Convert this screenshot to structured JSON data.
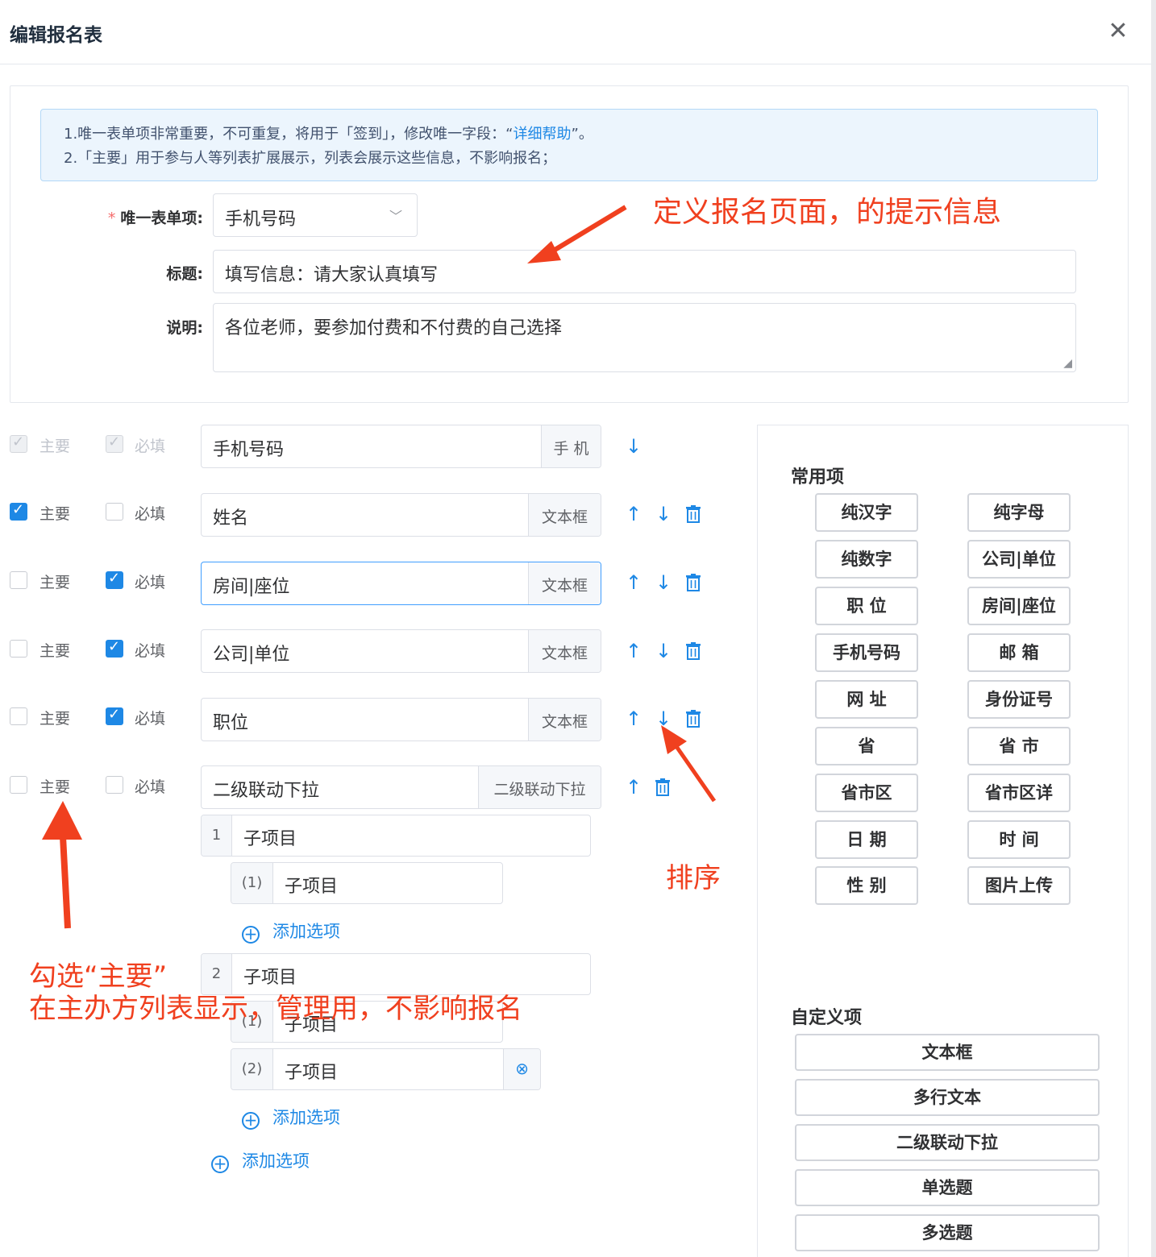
{
  "dialog": {
    "title": "编辑报名表",
    "close_icon": "close-icon"
  },
  "notice": {
    "line1_prefix": "1.唯一表单项非常重要，不可重复，将用于「签到」，修改唯一字段：“",
    "line1_link": "详细帮助",
    "line1_suffix": "”。",
    "line2": "2.「主要」用于参与人等列表扩展展示，列表会展示这些信息，不影响报名；"
  },
  "form": {
    "unique_label": "唯一表单项:",
    "unique_value": "手机号码",
    "title_label": "标题:",
    "title_value": "填写信息：请大家认真填写",
    "desc_label": "说明:",
    "desc_value": "各位老师，要参加付费和不付费的自己选择"
  },
  "row_labels": {
    "main": "主要",
    "required": "必填"
  },
  "fields": [
    {
      "name": "手机号码",
      "type": "手 机",
      "main": true,
      "required": true,
      "disabled": true
    },
    {
      "name": "姓名",
      "type": "文本框",
      "main": true,
      "required": false
    },
    {
      "name": "房间|座位",
      "type": "文本框",
      "main": false,
      "required": true
    },
    {
      "name": "公司|单位",
      "type": "文本框",
      "main": false,
      "required": true
    },
    {
      "name": "职位",
      "type": "文本框",
      "main": false,
      "required": true
    },
    {
      "name": "二级联动下拉",
      "type": "二级联动下拉",
      "main": false,
      "required": false
    }
  ],
  "cascade": {
    "level1": [
      {
        "index": "1",
        "value": "子项目",
        "children": [
          {
            "index": "(1)",
            "value": "子项目"
          }
        ]
      },
      {
        "index": "2",
        "value": "子项目",
        "children": [
          {
            "index": "(1)",
            "value": "子项目"
          },
          {
            "index": "(2)",
            "value": "子项目"
          }
        ]
      }
    ],
    "add_option": "添加选项"
  },
  "common_items": {
    "title": "常用项",
    "items": [
      "纯汉字",
      "纯字母",
      "纯数字",
      "公司|单位",
      "职 位",
      "房间|座位",
      "手机号码",
      "邮 箱",
      "网 址",
      "身份证号",
      "省",
      "省 市",
      "省市区",
      "省市区详",
      "日 期",
      "时 间",
      "性 别",
      "图片上传"
    ]
  },
  "custom_items": {
    "title": "自定义项",
    "items": [
      "文本框",
      "多行文本",
      "二级联动下拉",
      "单选题",
      "多选题"
    ]
  },
  "annotations": {
    "header_hint": "定义报名页面，的提示信息",
    "sort_hint": "排序",
    "main_hint_line1": "勾选“主要”",
    "main_hint_line2": "在主办方列表显示，管理用，不影响报名",
    "annotation_color": "#f0401f"
  },
  "colors": {
    "primary": "#1e88e5",
    "notice_bg": "#ecf5fd"
  }
}
